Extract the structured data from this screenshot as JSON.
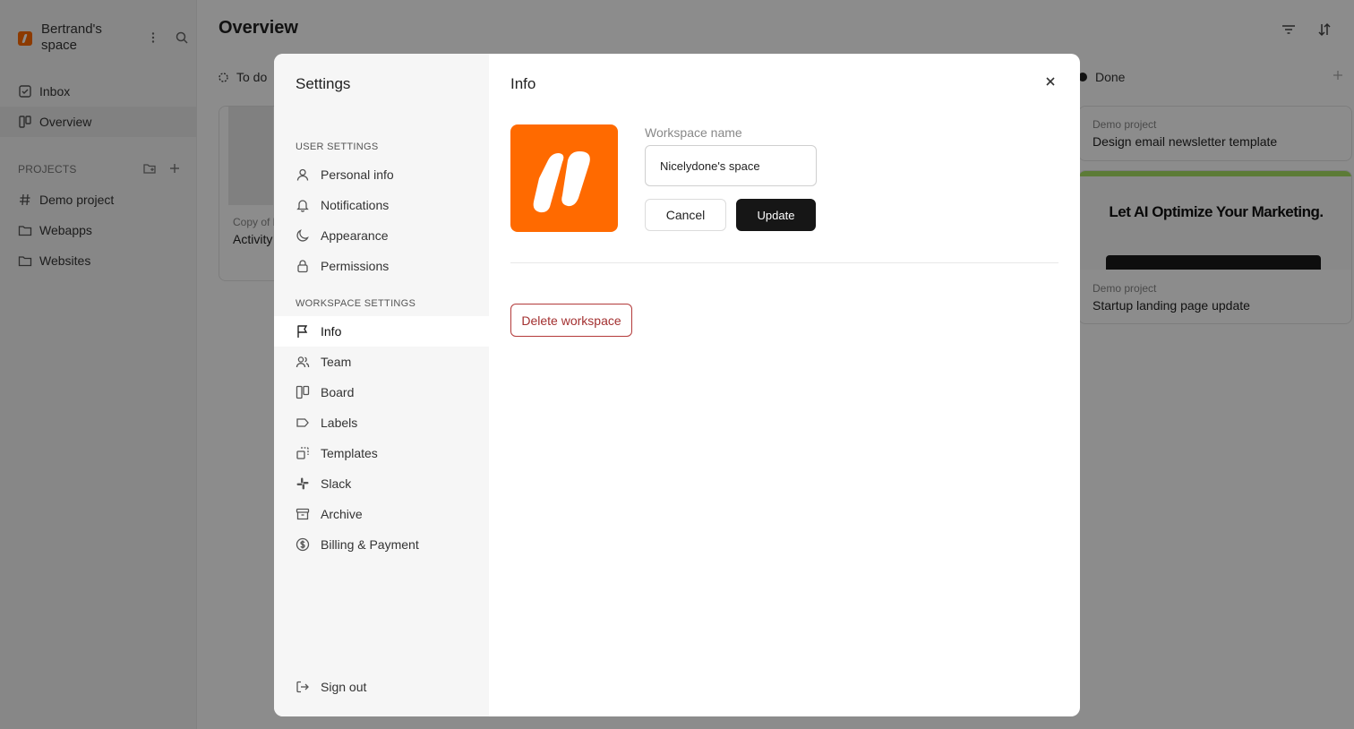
{
  "background": {
    "workspace_name": "Bertrand's space",
    "nav": {
      "inbox": "Inbox",
      "overview": "Overview"
    },
    "projects_label": "PROJECTS",
    "projects": [
      "Demo project",
      "Webapps",
      "Websites"
    ],
    "page_title": "Overview",
    "columns": {
      "todo": "To do",
      "done": "Done"
    },
    "todo_card": {
      "project": "Copy of l",
      "title": "Activity"
    },
    "done_cards": [
      {
        "project": "Demo project",
        "title": "Design email newsletter template"
      },
      {
        "project": "Demo project",
        "title": "Startup landing page update",
        "preview_headline": "Let AI Optimize Your Marketing."
      }
    ]
  },
  "settings": {
    "title": "Settings",
    "user_settings_label": "USER SETTINGS",
    "user_items": [
      "Personal info",
      "Notifications",
      "Appearance",
      "Permissions"
    ],
    "workspace_settings_label": "WORKSPACE SETTINGS",
    "workspace_items": [
      "Info",
      "Team",
      "Board",
      "Labels",
      "Templates",
      "Slack",
      "Archive",
      "Billing & Payment"
    ],
    "active_item": "Info",
    "sign_out": "Sign out"
  },
  "info": {
    "title": "Info",
    "workspace_name_label": "Workspace name",
    "workspace_name_value": "Nicelydone's space",
    "cancel_label": "Cancel",
    "update_label": "Update",
    "delete_label": "Delete workspace"
  },
  "colors": {
    "brand": "#ff6a00",
    "primary_button": "#161616",
    "danger": "#b33a3a"
  }
}
